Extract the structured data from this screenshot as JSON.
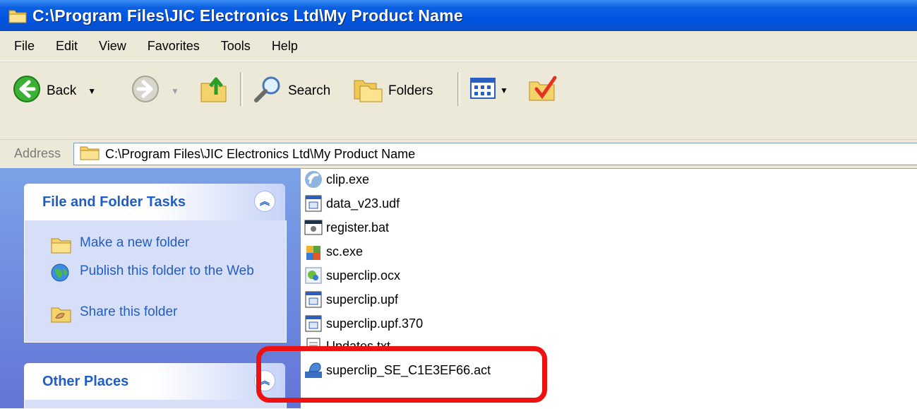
{
  "window": {
    "title": "C:\\Program Files\\JIC Electronics Ltd\\My Product Name"
  },
  "menu": [
    "File",
    "Edit",
    "View",
    "Favorites",
    "Tools",
    "Help"
  ],
  "toolbar": {
    "back_label": "Back",
    "search_label": "Search",
    "folders_label": "Folders"
  },
  "address": {
    "label": "Address",
    "value": "C:\\Program Files\\JIC Electronics Ltd\\My Product Name"
  },
  "tasks_panel": {
    "title": "File and Folder Tasks",
    "items": [
      {
        "label": "Make a new folder",
        "icon": "new-folder-icon"
      },
      {
        "label": "Publish this folder to the Web",
        "icon": "globe-icon"
      },
      {
        "label": "Share this folder",
        "icon": "share-folder-icon"
      }
    ]
  },
  "other_places": {
    "title": "Other Places"
  },
  "files": [
    {
      "name": "clip.exe",
      "icon": "clip-exe-icon"
    },
    {
      "name": "data_v23.udf",
      "icon": "udf-file-icon"
    },
    {
      "name": "register.bat",
      "icon": "batch-file-icon"
    },
    {
      "name": "sc.exe",
      "icon": "installer-exe-icon"
    },
    {
      "name": "superclip.ocx",
      "icon": "ocx-file-icon"
    },
    {
      "name": "superclip.upf",
      "icon": "upf-file-icon"
    },
    {
      "name": "superclip.upf.370",
      "icon": "upf-file-icon"
    },
    {
      "name": "Updates.txt",
      "icon": "text-file-icon"
    },
    {
      "name": "superclip_SE_C1E3EF66.act",
      "icon": "act-file-icon"
    }
  ],
  "colors": {
    "titlebar": "#0054e3",
    "panel_link": "#215dc6",
    "highlight": "#ee1111"
  }
}
